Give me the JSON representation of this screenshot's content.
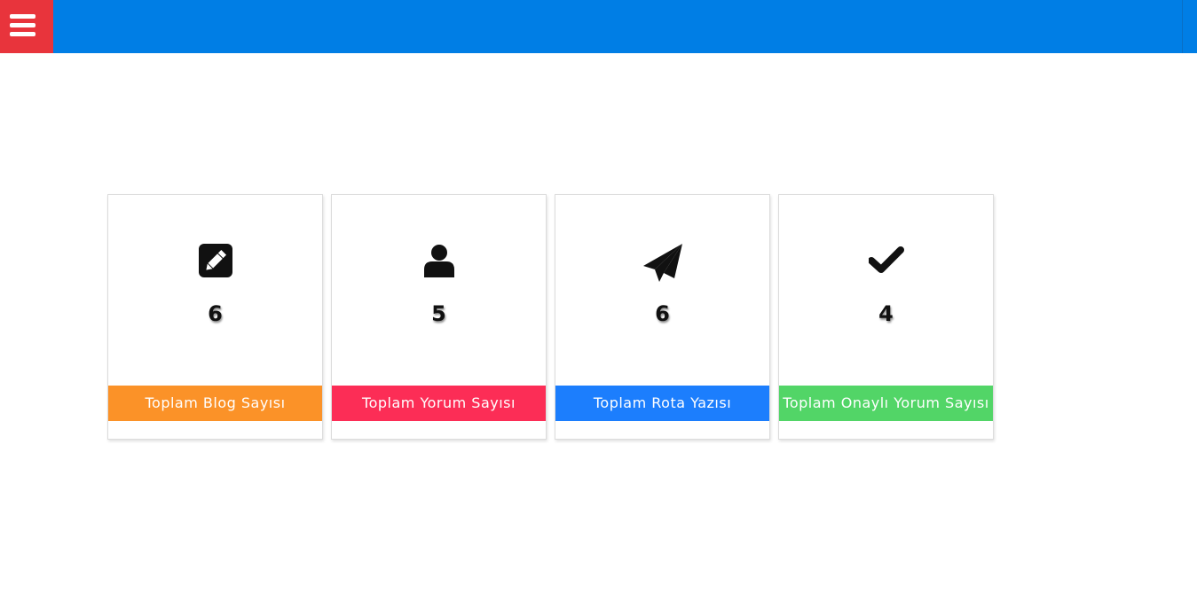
{
  "header": {
    "menu_icon": "hamburger-menu-icon",
    "bar_color": "#007ee5",
    "menu_button_color": "#e8343c"
  },
  "stats": [
    {
      "icon": "pencil-square-icon",
      "count": "6",
      "label": "Toplam Blog Sayısı",
      "color": "#fb9228"
    },
    {
      "icon": "user-icon",
      "count": "5",
      "label": "Toplam Yorum Sayısı",
      "color": "#fc2d56"
    },
    {
      "icon": "paper-plane-icon",
      "count": "6",
      "label": "Toplam Rota Yazısı",
      "color": "#1c7efd"
    },
    {
      "icon": "checkmark-icon",
      "count": "4",
      "label": "Toplam Onaylı Yorum Sayısı",
      "color": "#52d567"
    }
  ]
}
